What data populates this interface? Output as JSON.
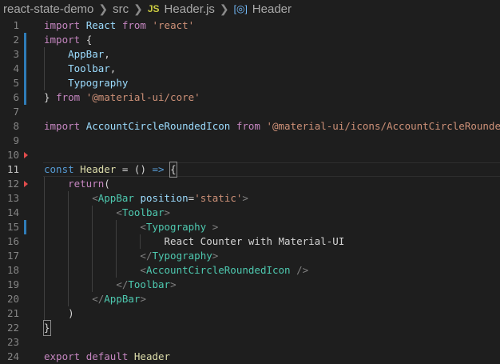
{
  "breadcrumb": {
    "project": "react-state-demo",
    "folder": "src",
    "file_badge": "JS",
    "file": "Header.js",
    "symbol": "Header"
  },
  "colors": {
    "background": "#1e1e1e",
    "keyword": "#c586c0",
    "identifier": "#9cdcfe",
    "string": "#ce9178",
    "component": "#4ec9b0",
    "gutter_modified": "#2f7cb8",
    "gutter_deleted": "#e04c4c"
  },
  "lines": {
    "l1": {
      "n": "1",
      "t": [
        "import",
        " ",
        "React",
        " ",
        "from",
        " ",
        "'react'"
      ]
    },
    "l2": {
      "n": "2",
      "t": [
        "import",
        " ",
        "{"
      ]
    },
    "l3": {
      "n": "3",
      "t": [
        "    ",
        "AppBar",
        ","
      ]
    },
    "l4": {
      "n": "4",
      "t": [
        "    ",
        "Toolbar",
        ","
      ]
    },
    "l5": {
      "n": "5",
      "t": [
        "    ",
        "Typography"
      ]
    },
    "l6": {
      "n": "6",
      "t": [
        "}",
        " ",
        "from",
        " ",
        "'@material-ui/core'"
      ]
    },
    "l7": {
      "n": "7",
      "t": []
    },
    "l8": {
      "n": "8",
      "t": [
        "import",
        " ",
        "AccountCircleRoundedIcon",
        " ",
        "from",
        " ",
        "'@material-ui/icons/AccountCircleRounded'",
        ";"
      ]
    },
    "l9": {
      "n": "9",
      "t": []
    },
    "l10": {
      "n": "10",
      "t": []
    },
    "l11": {
      "n": "11",
      "t": [
        "const",
        " ",
        "Header",
        " ",
        "=",
        " ",
        "()",
        " ",
        "=>",
        " ",
        "{"
      ]
    },
    "l12": {
      "n": "12",
      "t": [
        "    ",
        "return",
        "("
      ]
    },
    "l13": {
      "n": "13",
      "t": [
        "        ",
        "<",
        "AppBar",
        " ",
        "position",
        "=",
        "'static'",
        ">"
      ]
    },
    "l14": {
      "n": "14",
      "t": [
        "            ",
        "<",
        "Toolbar",
        ">"
      ]
    },
    "l15": {
      "n": "15",
      "t": [
        "                ",
        "<",
        "Typography",
        " >"
      ]
    },
    "l16": {
      "n": "16",
      "t": [
        "                    ",
        "React Counter with Material-UI"
      ]
    },
    "l17": {
      "n": "17",
      "t": [
        "                ",
        "</",
        "Typography",
        ">"
      ]
    },
    "l18": {
      "n": "18",
      "t": [
        "                ",
        "<",
        "AccountCircleRoundedIcon",
        " />"
      ]
    },
    "l19": {
      "n": "19",
      "t": [
        "            ",
        "</",
        "Toolbar",
        ">"
      ]
    },
    "l20": {
      "n": "20",
      "t": [
        "        ",
        "</",
        "AppBar",
        ">"
      ]
    },
    "l21": {
      "n": "21",
      "t": [
        "    ",
        ")"
      ]
    },
    "l22": {
      "n": "22",
      "t": [
        "}"
      ]
    },
    "l23": {
      "n": "23",
      "t": []
    },
    "l24": {
      "n": "24",
      "t": [
        "export",
        " ",
        "default",
        " ",
        "Header"
      ]
    }
  }
}
